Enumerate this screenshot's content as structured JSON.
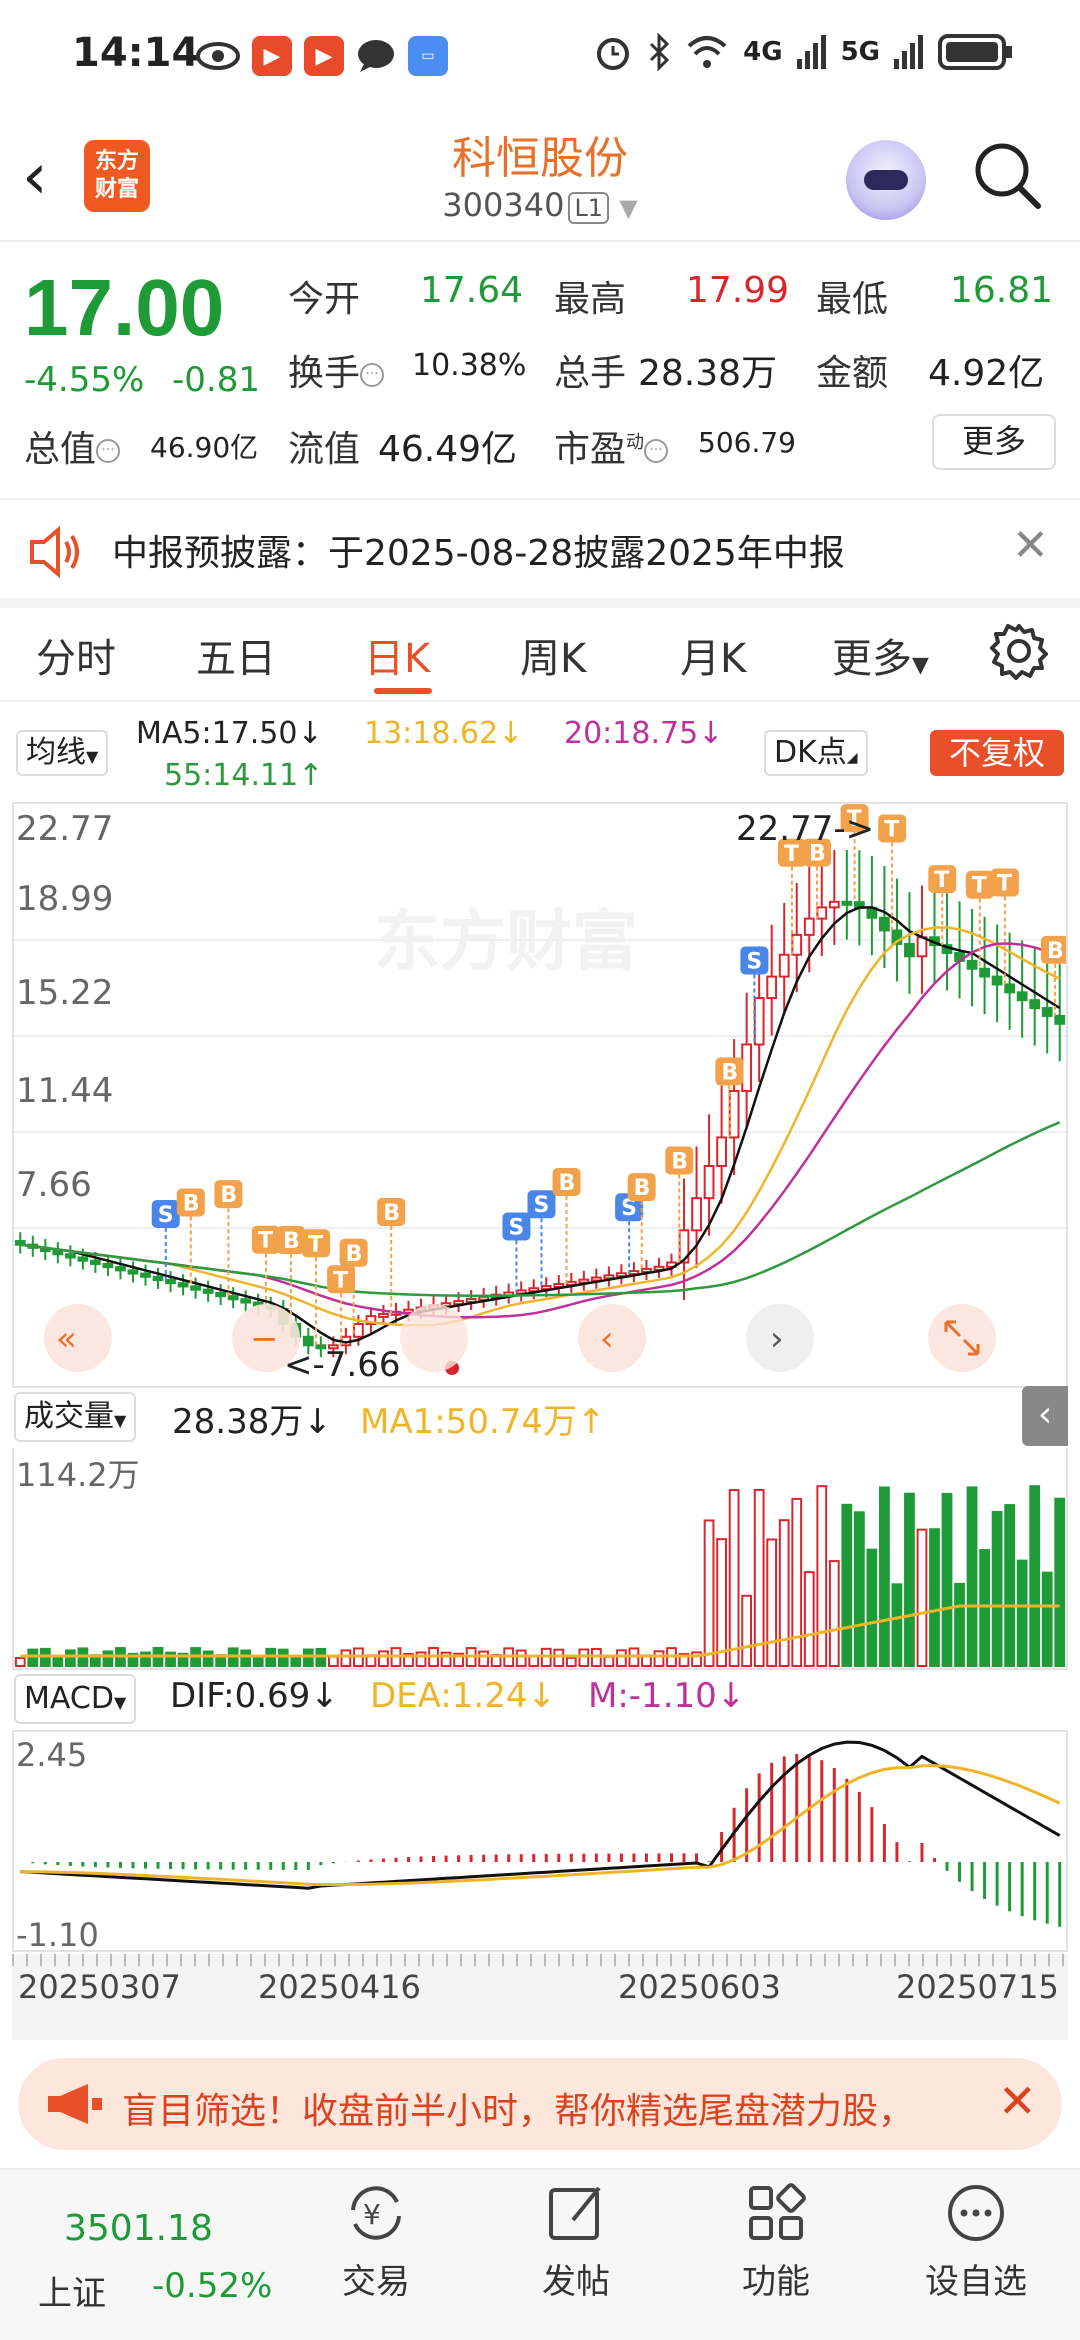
{
  "statusbar": {
    "time": "14:14",
    "net1": "4G",
    "net2": "5G"
  },
  "header": {
    "brand_line1": "东方",
    "brand_line2": "财富",
    "name": "科恒股份",
    "code": "300340",
    "level": "L1"
  },
  "quote": {
    "price": "17.00",
    "change_pct": "-4.55%",
    "change": "-0.81",
    "open_label": "今开",
    "open": "17.64",
    "high_label": "最高",
    "high": "17.99",
    "low_label": "最低",
    "low": "16.81",
    "turnover_label": "换手",
    "turnover": "10.38%",
    "volume_label": "总手",
    "volume": "28.38万",
    "amount_label": "金额",
    "amount": "4.92亿",
    "total_mv_label": "总值",
    "total_mv": "46.90亿",
    "float_mv_label": "流值",
    "float_mv": "46.49亿",
    "pe_label": "市盈",
    "pe_sup": "动",
    "pe": "506.79",
    "more": "更多"
  },
  "notice": {
    "text": "中报预披露：于2025-08-28披露2025年中报"
  },
  "tabs": [
    "分时",
    "五日",
    "日K",
    "周K",
    "月K",
    "更多"
  ],
  "ma": {
    "selector": "均线",
    "ma5": "MA5:17.50↓",
    "ma13": "13:18.62↓",
    "ma20": "20:18.75↓",
    "ma55": "55:14.11↑",
    "dk": "DK点",
    "adjust": "不复权"
  },
  "kline": {
    "y_ticks": [
      "22.77",
      "18.99",
      "15.22",
      "11.44",
      "7.66"
    ],
    "max_label": "22.77->",
    "min_label": "<-7.66"
  },
  "volume": {
    "selector": "成交量",
    "value": "28.38万↓",
    "ma1": "MA1:50.74万↑",
    "y_top": "114.2万"
  },
  "macd": {
    "selector": "MACD",
    "dif": "DIF:0.69↓",
    "dea": "DEA:1.24↓",
    "m": "M:-1.10↓",
    "y_top": "2.45",
    "y_bottom": "-1.10"
  },
  "x_dates": [
    "20250307",
    "20250416",
    "20250603",
    "20250715"
  ],
  "promo": {
    "text": "盲目筛选！收盘前半小时，帮你精选尾盘潜力股，"
  },
  "bottom": {
    "index_value": "3501.18",
    "index_name": "上证",
    "index_change": "-0.52%",
    "nav": [
      "交易",
      "发帖",
      "功能",
      "设自选"
    ]
  },
  "colors": {
    "up": "#d9262d",
    "down": "#1e9a36",
    "accent": "#e8502a",
    "ma5": "#111111",
    "ma13": "#f0b429",
    "ma20": "#c0309a",
    "ma55": "#2f9a3c"
  }
}
